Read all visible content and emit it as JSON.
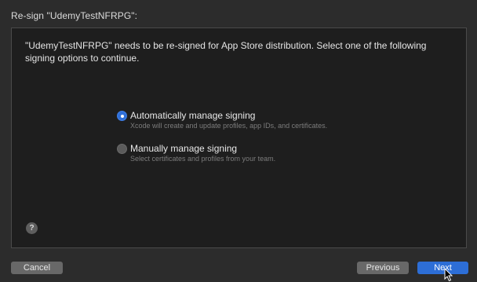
{
  "dialog": {
    "title": "Re-sign \"UdemyTestNFRPG\":",
    "message": "\"UdemyTestNFRPG\" needs to be re-signed for App Store distribution. Select one of the following signing options to continue."
  },
  "options": [
    {
      "label": "Automatically manage signing",
      "description": "Xcode will create and update profiles, app IDs, and certificates.",
      "selected": true
    },
    {
      "label": "Manually manage signing",
      "description": "Select certificates and profiles from your team.",
      "selected": false
    }
  ],
  "help": {
    "label": "?"
  },
  "buttons": {
    "cancel": "Cancel",
    "previous": "Previous",
    "next": "Next"
  },
  "colors": {
    "accent": "#2d6ed6",
    "background": "#2c2c2c",
    "panel": "#1e1e1e"
  }
}
